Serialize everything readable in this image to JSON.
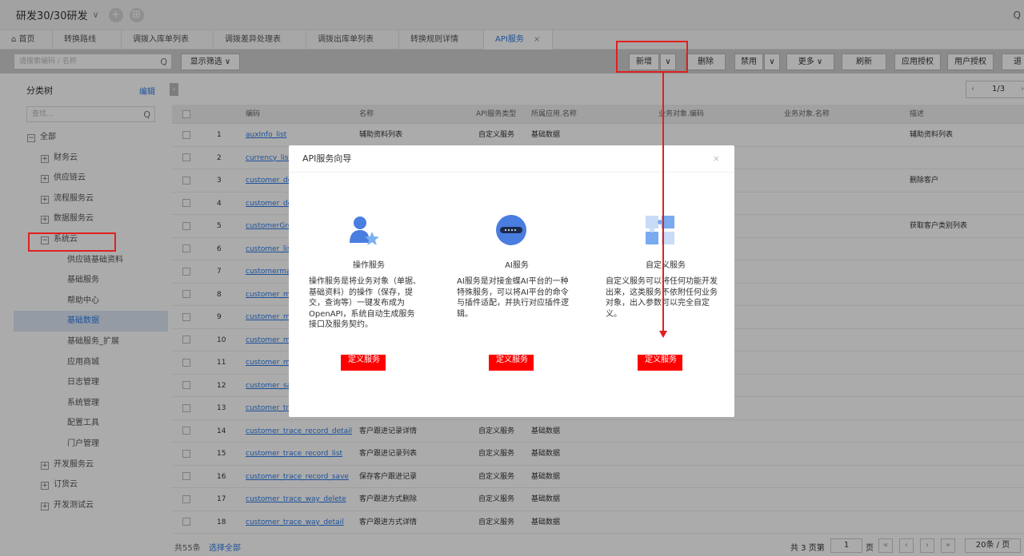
{
  "topbar": {
    "title": "研发30/30研发",
    "chevron": "∨",
    "add": "+",
    "grid": "⊞",
    "search": "Q"
  },
  "tabs": [
    {
      "label": "⌂ 首页"
    },
    {
      "label": "转换路线"
    },
    {
      "label": "调拨入库单列表"
    },
    {
      "label": "调拨差异处理表"
    },
    {
      "label": "调拨出库单列表"
    },
    {
      "label": "转换规则详情"
    },
    {
      "label": "API服务",
      "close": "×"
    }
  ],
  "toolbar": {
    "search_placeholder": "请搜索编码 / 名称",
    "filter": "显示筛选 ∨",
    "new": "新增",
    "new_drop": "∨",
    "delete": "删除",
    "disable": "禁用",
    "disable_drop": "∨",
    "more": "更多 ∨",
    "refresh": "刷新",
    "app_auth": "应用授权",
    "user_auth": "用户授权",
    "exit": "退"
  },
  "sidebar": {
    "title": "分类树",
    "edit": "编辑",
    "search_placeholder": "查找...",
    "items": [
      {
        "label": "全部",
        "box": "−"
      },
      {
        "label": "财务云",
        "box": "+"
      },
      {
        "label": "供应链云",
        "box": "+"
      },
      {
        "label": "流程服务云",
        "box": "+"
      },
      {
        "label": "数据服务云",
        "box": "+"
      },
      {
        "label": "系统云",
        "box": "−"
      },
      {
        "label": "供应链基础资料"
      },
      {
        "label": "基础服务"
      },
      {
        "label": "帮助中心"
      },
      {
        "label": "基础数据"
      },
      {
        "label": "基础服务_扩展"
      },
      {
        "label": "应用商城"
      },
      {
        "label": "日志管理"
      },
      {
        "label": "系统管理"
      },
      {
        "label": "配置工具"
      },
      {
        "label": "门户管理"
      },
      {
        "label": "开发服务云",
        "box": "+"
      },
      {
        "label": "订货云",
        "box": "+"
      },
      {
        "label": "开发测试云",
        "box": "+"
      }
    ]
  },
  "grid": {
    "headers": {
      "code": "编码",
      "name": "名称",
      "type": "API服务类型",
      "app": "所属应用.名称",
      "obj_code": "业务对象.编码",
      "obj_name": "业务对象.名称",
      "desc": "描述"
    },
    "rows": [
      {
        "n": "1",
        "code": "auxInfo_list",
        "name": "辅助资料列表",
        "type": "自定义服务",
        "app": "基础数据",
        "desc": "辅助资料列表"
      },
      {
        "n": "2",
        "code": "currency_list",
        "name": "",
        "type": "",
        "app": "",
        "desc": ""
      },
      {
        "n": "3",
        "code": "customer_del",
        "name": "",
        "type": "",
        "app": "",
        "desc": "删除客户"
      },
      {
        "n": "4",
        "code": "customer_det",
        "name": "",
        "type": "",
        "app": "",
        "desc": ""
      },
      {
        "n": "5",
        "code": "customerGro",
        "name": "",
        "type": "",
        "app": "",
        "desc": "获取客户类别列表"
      },
      {
        "n": "6",
        "code": "customer_list",
        "name": "",
        "type": "",
        "app": "",
        "desc": ""
      },
      {
        "n": "7",
        "code": "customermat",
        "name": "",
        "type": "",
        "app": "",
        "desc": ""
      },
      {
        "n": "8",
        "code": "customer_ma",
        "name": "",
        "type": "",
        "app": "",
        "desc": ""
      },
      {
        "n": "9",
        "code": "customer_ma",
        "name": "",
        "type": "",
        "app": "",
        "desc": ""
      },
      {
        "n": "10",
        "code": "customer_ma",
        "name": "",
        "type": "",
        "app": "",
        "desc": ""
      },
      {
        "n": "11",
        "code": "customer_ma",
        "name": "",
        "type": "",
        "app": "",
        "desc": ""
      },
      {
        "n": "12",
        "code": "customer_sav",
        "name": "",
        "type": "",
        "app": "",
        "desc": ""
      },
      {
        "n": "13",
        "code": "customer_tra",
        "name": "",
        "type": "",
        "app": "",
        "desc": ""
      },
      {
        "n": "14",
        "code": "customer_trace_record_detail",
        "name": "客户跟进记录详情",
        "type": "自定义服务",
        "app": "基础数据",
        "desc": ""
      },
      {
        "n": "15",
        "code": "customer_trace_record_list",
        "name": "客户跟进记录列表",
        "type": "自定义服务",
        "app": "基础数据",
        "desc": ""
      },
      {
        "n": "16",
        "code": "customer_trace_record_save",
        "name": "保存客户跟进记录",
        "type": "自定义服务",
        "app": "基础数据",
        "desc": ""
      },
      {
        "n": "17",
        "code": "customer_trace_way_delete",
        "name": "客户跟进方式删除",
        "type": "自定义服务",
        "app": "基础数据",
        "desc": ""
      },
      {
        "n": "18",
        "code": "customer_trace_way_detail",
        "name": "客户跟进方式详情",
        "type": "自定义服务",
        "app": "基础数据",
        "desc": ""
      }
    ]
  },
  "pager": {
    "top_label": "1/3",
    "prev": "‹",
    "next": "›",
    "total": "共55条",
    "select_all": "选择全部",
    "pages_pre": "共 3 页第",
    "page_num": "1",
    "pages_post": "页",
    "page_size": "20条 / 页"
  },
  "dialog": {
    "title": "API服务向导",
    "close": "×",
    "cards": [
      {
        "name": "操作服务",
        "desc": "操作服务是将业务对象（单据、基础资料）的操作（保存，提交，查询等）一键发布成为OpenAPI，系统自动生成服务接口及服务契约。",
        "button": "定义服务"
      },
      {
        "name": "AI服务",
        "desc": "AI服务是对接金蝶AI平台的一种特殊服务，可以将AI平台的命令与插件适配，并执行对应插件逻辑。",
        "button": "定义服务"
      },
      {
        "name": "自定义服务",
        "desc": "自定义服务可以将任何功能开发出来，这类服务不依附任何业务对象，出入参数可以完全自定义。",
        "button": "定义服务"
      }
    ]
  },
  "colors": {
    "accent": "#2c7be5",
    "danger": "#ff0000",
    "annotation": "#e02020"
  }
}
